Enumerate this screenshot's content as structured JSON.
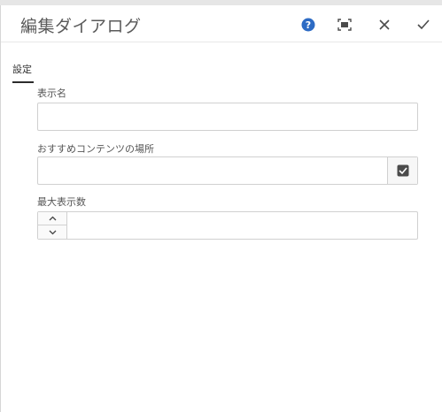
{
  "dialog": {
    "title": "編集ダイアログ",
    "header_buttons": {
      "help": "help-icon",
      "fullscreen": "fullscreen-icon",
      "close": "close-icon",
      "done": "checkmark-icon"
    }
  },
  "tabs": [
    {
      "label": "設定",
      "active": true
    }
  ],
  "form": {
    "display_name": {
      "label": "表示名",
      "value": ""
    },
    "recommended_location": {
      "label": "おすすめコンテンツの場所",
      "value": "",
      "picker_icon": "path-picker-icon"
    },
    "max_display_count": {
      "label": "最大表示数",
      "value": "",
      "step_up_icon": "chevron-up-icon",
      "step_down_icon": "chevron-down-icon"
    }
  },
  "colors": {
    "help_accent": "#2d6bc4",
    "header_icon": "#4b4b4b",
    "border": "#d0d0d0"
  }
}
